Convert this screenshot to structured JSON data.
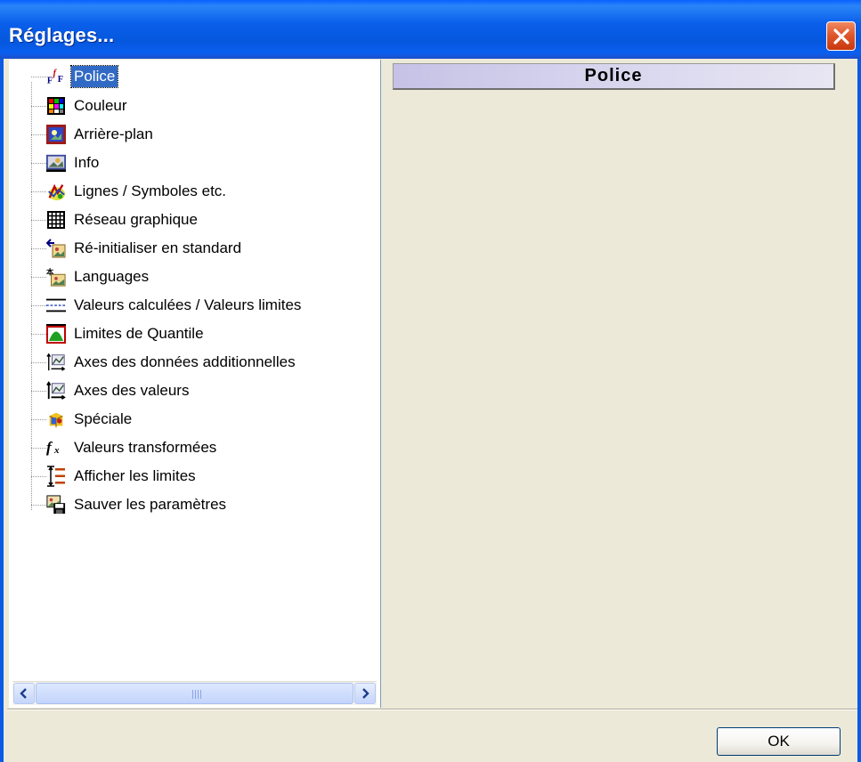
{
  "window": {
    "title": "Réglages...",
    "close_label": "Close"
  },
  "tree": {
    "items": [
      {
        "label": "Police",
        "icon": "font-icon",
        "selected": true
      },
      {
        "label": "Couleur",
        "icon": "color-palette-icon"
      },
      {
        "label": "Arrière-plan",
        "icon": "background-image-icon"
      },
      {
        "label": "Info",
        "icon": "info-image-icon"
      },
      {
        "label": "Lignes / Symboles etc.",
        "icon": "lines-symbols-icon"
      },
      {
        "label": "Réseau graphique",
        "icon": "grid-icon"
      },
      {
        "label": "Ré-initialiser en standard",
        "icon": "reset-icon"
      },
      {
        "label": "Languages",
        "icon": "language-icon"
      },
      {
        "label": "Valeurs calculées / Valeurs limites",
        "icon": "limit-lines-icon"
      },
      {
        "label": "Limites de Quantile",
        "icon": "quantile-icon"
      },
      {
        "label": "Axes des données additionnelles",
        "icon": "additional-axes-icon"
      },
      {
        "label": "Axes des valeurs",
        "icon": "value-axes-icon"
      },
      {
        "label": "Spéciale",
        "icon": "special-icon"
      },
      {
        "label": "Valeurs transformées",
        "icon": "function-icon"
      },
      {
        "label": "Afficher les limites",
        "icon": "show-limits-icon"
      },
      {
        "label": "Sauver les paramètres",
        "icon": "save-settings-icon"
      }
    ]
  },
  "panel": {
    "header": "Police"
  },
  "footer": {
    "ok_label": "OK"
  },
  "colors": {
    "titlebar": "#0a5fea",
    "selection": "#316ac5",
    "dialog_bg": "#ece9d8"
  }
}
